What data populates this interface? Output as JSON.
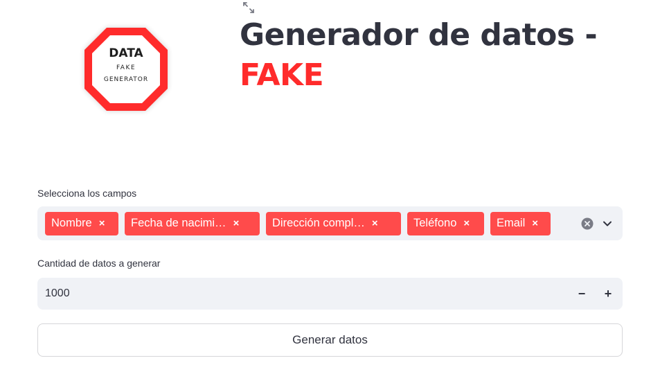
{
  "header": {
    "logo": {
      "line1": "DATA",
      "line2": "FAKE",
      "line3": "GENERATOR",
      "border_color": "#ff2b2b"
    },
    "title_main": "Generador de datos -",
    "title_accent": "FAKE",
    "accent_color": "#ff2b2b",
    "expand_icon": "fullscreen-expand-icon"
  },
  "fields_select": {
    "label": "Selecciona los campos",
    "tags": [
      {
        "label": "Nombre"
      },
      {
        "label": "Fecha de nacimi…"
      },
      {
        "label": "Dirección compl…"
      },
      {
        "label": "Teléfono"
      },
      {
        "label": "Email"
      }
    ],
    "tag_remove_glyph": "×",
    "tag_color": "#ff4b4b",
    "clear_icon": "clear-all-icon",
    "dropdown_icon": "chevron-down-icon"
  },
  "quantity": {
    "label": "Cantidad de datos a generar",
    "value": "1000",
    "decrement": "−",
    "increment": "+"
  },
  "generate_button": {
    "label": "Generar datos"
  }
}
